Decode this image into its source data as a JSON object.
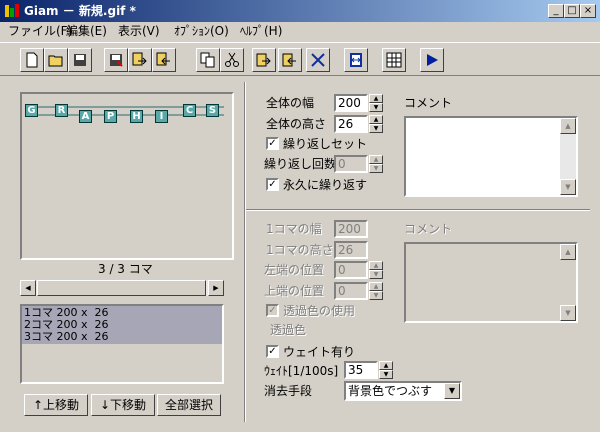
{
  "window": {
    "title": "Giam － 新規.gif *"
  },
  "menu": [
    "ファイル(F)",
    "編集(E)",
    "表示(V)",
    "ｵﾌﾟｼｮﾝ(O)",
    "ﾍﾙﾌﾟ(H)"
  ],
  "preview": {
    "letters": [
      "G",
      "R",
      "A",
      "P",
      "H",
      "I",
      "C",
      "S"
    ],
    "frame_counter": "3 / 3 コマ"
  },
  "frame_list": [
    "1コマ 200 x  26",
    "2コマ 200 x  26",
    "3コマ 200 x  26"
  ],
  "buttons": {
    "move_up": "↑上移動",
    "move_down": "↓下移動",
    "select_all": "全部選択"
  },
  "global": {
    "width_label": "全体の幅",
    "width_value": "200",
    "height_label": "全体の高さ",
    "height_value": "26",
    "repeat_set_label": "繰り返しセット",
    "repeat_set_checked": true,
    "repeat_count_label": "繰り返し回数",
    "repeat_count_value": "0",
    "loop_forever_label": "永久に繰り返す",
    "loop_forever_checked": true,
    "comment_label": "コメント"
  },
  "frame": {
    "width_label": "1コマの幅",
    "width_value": "200",
    "height_label": "1コマの高さ",
    "height_value": "26",
    "left_label": "左端の位置",
    "left_value": "0",
    "top_label": "上端の位置",
    "top_value": "0",
    "transparent_label": "透過色の使用",
    "transparent_color_label": "透過色",
    "comment_label": "コメント",
    "wait_label": "ウェイト有り",
    "wait_checked": true,
    "wait_value_label": "ｳｪｲﾄ[1/100s]",
    "wait_value": "35",
    "disposal_label": "消去手段",
    "disposal_value": "背景色でつぶす"
  }
}
